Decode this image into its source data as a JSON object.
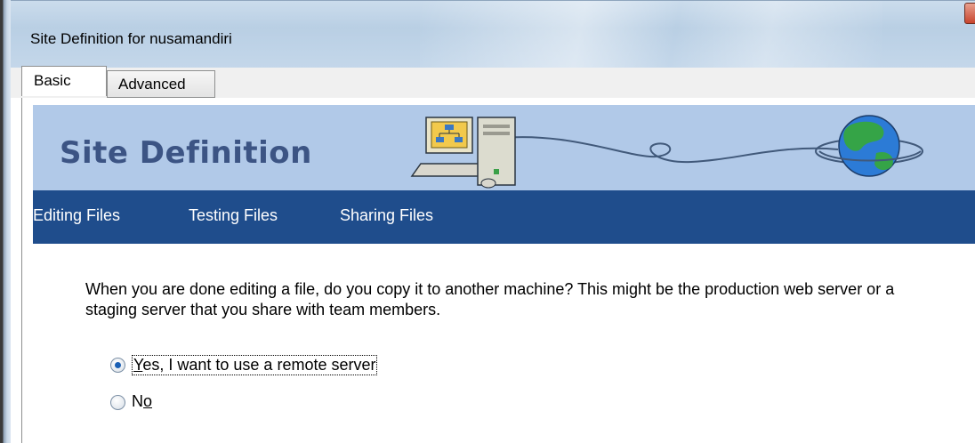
{
  "window": {
    "title": "Site Definition for nusamandiri"
  },
  "tabs": [
    {
      "label": "Basic",
      "active": true
    },
    {
      "label": "Advanced",
      "active": false
    }
  ],
  "banner": {
    "title": "Site Definition",
    "art_icons": [
      "computer-icon",
      "globe-icon"
    ]
  },
  "nav": {
    "items": [
      "Editing Files",
      "Testing Files",
      "Sharing Files"
    ]
  },
  "main": {
    "question": "When you are done editing a file, do you copy it to another machine? This might be the production web server or a staging server that you share with team members.",
    "options": [
      {
        "label_mnemonic": "Y",
        "label_rest": "es, I want to use a remote server",
        "selected": true
      },
      {
        "label_prefix": "N",
        "label_mnemonic": "o",
        "selected": false
      }
    ]
  },
  "colors": {
    "banner_bg": "#b1c9e8",
    "banner_title": "#3c5484",
    "nav_bg": "#1f4d8c",
    "radio_dot": "#1a5fb4"
  }
}
